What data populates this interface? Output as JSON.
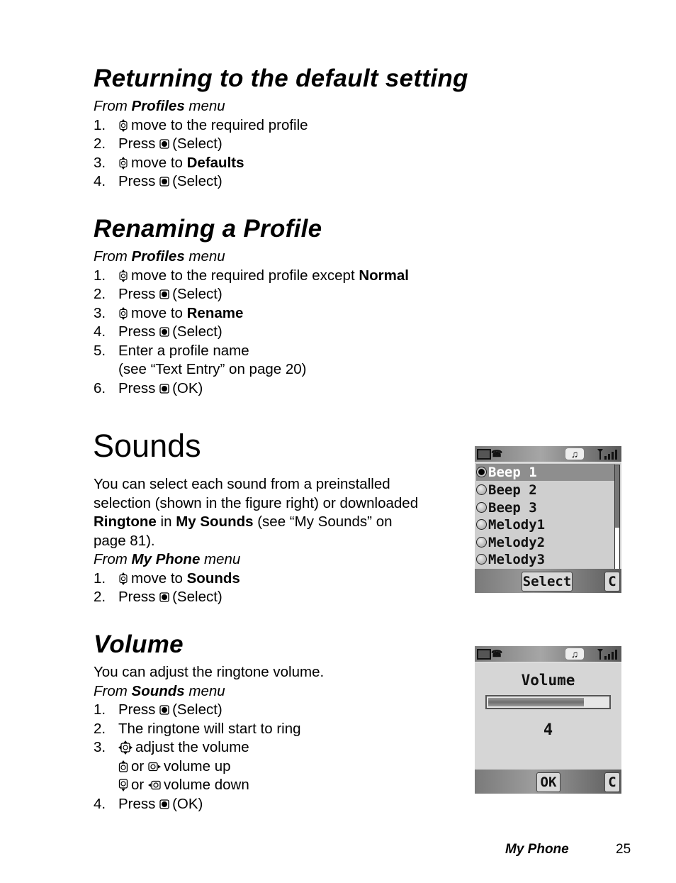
{
  "sections": {
    "returning": {
      "title": "Returning to the default setting",
      "from": {
        "prefix": "From ",
        "menu": "Profiles",
        "suffix": " menu"
      },
      "steps": [
        {
          "num": "1.",
          "icon": "nav-up-down-icon",
          "text": "move to the required profile"
        },
        {
          "num": "2.",
          "pre": "Press",
          "icon": "select-key-icon",
          "text": "(Select)"
        },
        {
          "num": "3.",
          "icon": "nav-up-down-icon",
          "text": "move to ",
          "bold": "Defaults"
        },
        {
          "num": "4.",
          "pre": "Press",
          "icon": "select-key-icon",
          "text": "(Select)"
        }
      ]
    },
    "renaming": {
      "title": "Renaming a Profile",
      "from": {
        "prefix": "From ",
        "menu": "Profiles",
        "suffix": " menu"
      },
      "steps": [
        {
          "num": "1.",
          "icon": "nav-up-down-icon",
          "text": "move to the required profile except ",
          "bold": "Normal"
        },
        {
          "num": "2.",
          "pre": "Press",
          "icon": "select-key-icon",
          "text": "(Select)"
        },
        {
          "num": "3.",
          "icon": "nav-up-down-icon",
          "text": "move to ",
          "bold": "Rename"
        },
        {
          "num": "4.",
          "pre": "Press",
          "icon": "select-key-icon",
          "text": "(Select)"
        },
        {
          "num": "5.",
          "text": "Enter a profile name",
          "cont": "(see “Text Entry” on page 20)"
        },
        {
          "num": "6.",
          "pre": "Press",
          "icon": "select-key-icon",
          "text": "(OK)"
        }
      ]
    },
    "sounds": {
      "title": "Sounds",
      "intro": {
        "l1": "You can select each sound from a preinstalled",
        "l2": "selection (shown in the figure right) or downloaded",
        "l3_b1": "Ringtone",
        "l3_t1": " in ",
        "l3_b2": "My Sounds",
        "l3_t2": " (see “My Sounds” on",
        "l4": "page 81)."
      },
      "from": {
        "prefix": "From ",
        "menu": "My Phone",
        "suffix": " menu"
      },
      "steps": [
        {
          "num": "1.",
          "icon": "nav-up-down-icon",
          "text": "move to ",
          "bold": "Sounds"
        },
        {
          "num": "2.",
          "pre": "Press",
          "icon": "select-key-icon",
          "text": "(Select)"
        }
      ],
      "screen": {
        "items": [
          {
            "label": "Beep 1",
            "selected": true
          },
          {
            "label": "Beep 2",
            "selected": false
          },
          {
            "label": "Beep 3",
            "selected": false
          },
          {
            "label": "Melody1",
            "selected": false
          },
          {
            "label": "Melody2",
            "selected": false
          },
          {
            "label": "Melody3",
            "selected": false
          }
        ],
        "softkey_left": "Select",
        "softkey_right": "C",
        "status_icons": [
          "battery-icon",
          "profile-1-icon",
          "ringer-vibrate-icon",
          "signal-strength-icon"
        ]
      }
    },
    "volume": {
      "title": "Volume",
      "intro": "You can adjust the ringtone volume.",
      "from": {
        "prefix": "From ",
        "menu": "Sounds",
        "suffix": " menu"
      },
      "steps": [
        {
          "num": "1.",
          "pre": "Press",
          "icon": "select-key-icon",
          "text": "(Select)"
        },
        {
          "num": "2.",
          "text": "The ringtone will start to ring"
        },
        {
          "num": "3.",
          "icon": "nav-4way-icon",
          "text": "adjust the volume"
        },
        {
          "sub": true,
          "icon1": "nav-up-icon",
          "or": "or",
          "icon2": "nav-right-icon",
          "text": "volume up"
        },
        {
          "sub": true,
          "icon1": "nav-down-icon",
          "or": "or",
          "icon2": "nav-left-icon",
          "text": "volume down"
        },
        {
          "num": "4.",
          "pre": "Press",
          "icon": "select-key-icon",
          "text": "(OK)"
        }
      ],
      "screen": {
        "title": "Volume",
        "level": 4,
        "level_fraction": 0.8,
        "softkey_center": "OK",
        "softkey_right": "C"
      }
    }
  },
  "footer": {
    "section": "My Phone",
    "page": "25"
  }
}
